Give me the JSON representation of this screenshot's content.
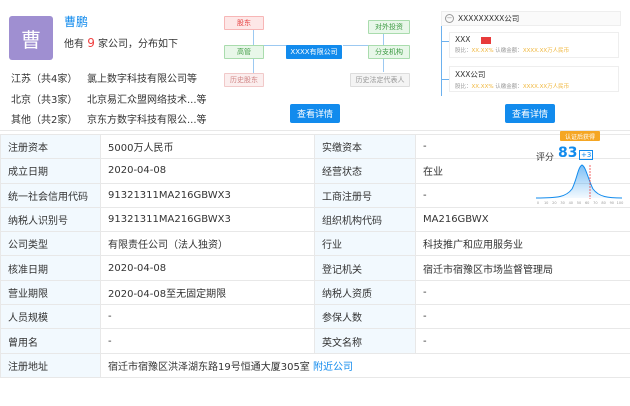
{
  "person": {
    "avatar_char": "曹",
    "name": "曹鹏",
    "summary_prefix": "他有",
    "company_count": "9",
    "summary_suffix": "家公司，分布如下",
    "regions": [
      {
        "region": "江苏（共4家）",
        "company": "氯上数字科技有限公司等"
      },
      {
        "region": "北京（共3家）",
        "company": "北京易汇众盟网络技术...等"
      },
      {
        "region": "其他（共2家）",
        "company": "京东方数字科技有限公...等"
      }
    ]
  },
  "equity": {
    "shareholder": "股东",
    "external_invest": "对外投资",
    "executive": "高管",
    "center": "XXXX有限公司",
    "branch": "分支机构",
    "history_shareholder": "历史股东",
    "history_legal_rep": "历史法定代表人",
    "detail_button": "查看详情"
  },
  "relation": {
    "company": "XXXXXXXXX公司",
    "card1_title": "XXX",
    "card1_sub_prefix": "股比：",
    "card1_ratio": "XX.XX%",
    "card1_mid": "  认缴金额：",
    "card1_amount": "XXXX.XX万人民币",
    "card2_title": "XXX公司",
    "card2_sub_prefix": "股比：",
    "card2_ratio": "XX.XX%",
    "card2_mid": "  认缴金额：",
    "card2_amount": "XXXX.XX万人民币",
    "detail_button": "查看详情"
  },
  "score": {
    "badge": "认证后获得",
    "label": "评分",
    "value": "83",
    "plus": "+3",
    "axis_ticks": [
      "0",
      "10",
      "20",
      "30",
      "40",
      "50",
      "60",
      "70",
      "80",
      "90",
      "100"
    ]
  },
  "info": [
    {
      "k1": "注册资本",
      "v1": "5000万人民币",
      "k2": "实缴资本",
      "v2": "-"
    },
    {
      "k1": "成立日期",
      "v1": "2020-04-08",
      "k2": "经营状态",
      "v2": "在业"
    },
    {
      "k1": "统一社会信用代码",
      "v1": "91321311MA216GBWX3",
      "k2": "工商注册号",
      "v2": "-"
    },
    {
      "k1": "纳税人识别号",
      "v1": "91321311MA216GBWX3",
      "k2": "组织机构代码",
      "v2": "MA216GBWX"
    },
    {
      "k1": "公司类型",
      "v1": "有限责任公司（法人独资）",
      "k2": "行业",
      "v2": "科技推广和应用服务业"
    },
    {
      "k1": "核准日期",
      "v1": "2020-04-08",
      "k2": "登记机关",
      "v2": "宿迁市宿豫区市场监督管理局"
    },
    {
      "k1": "营业期限",
      "v1": "2020-04-08至无固定期限",
      "k2": "纳税人资质",
      "v2": "-"
    },
    {
      "k1": "人员规模",
      "v1": "-",
      "k2": "参保人数",
      "v2": "-"
    },
    {
      "k1": "曾用名",
      "v1": "-",
      "k2": "英文名称",
      "v2": "-"
    }
  ],
  "address": {
    "label": "注册地址",
    "value": "宿迁市宿豫区洪泽湖东路19号恒通大厦305室",
    "link": "附近公司"
  }
}
